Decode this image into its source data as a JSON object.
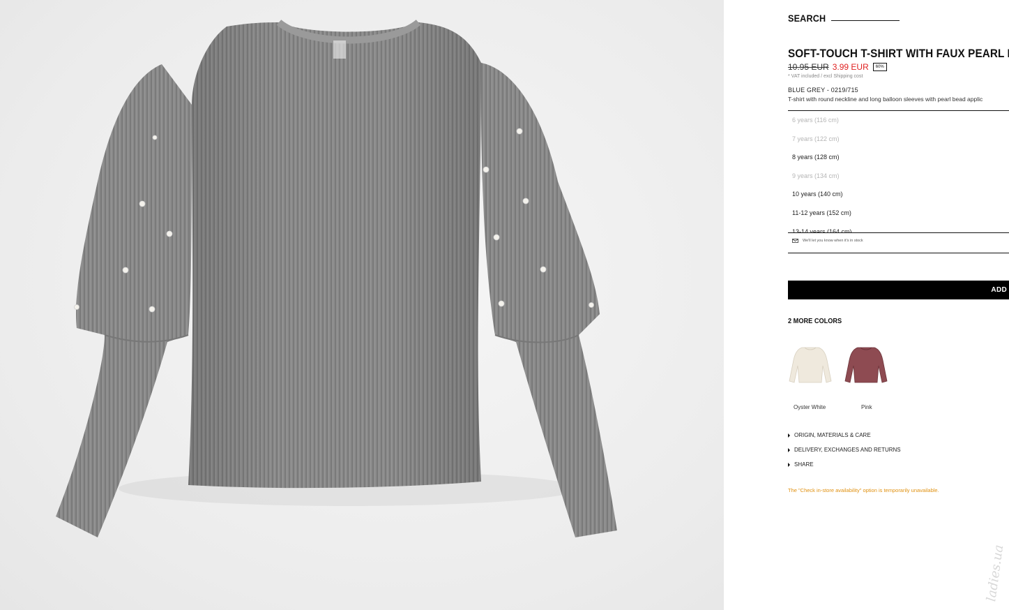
{
  "header": {
    "search_label": "SEARCH"
  },
  "product": {
    "title": "SOFT-TOUCH T-SHIRT WITH FAUX PEARL BEA",
    "old_price": "10.95 EUR",
    "new_price": "3.99 EUR",
    "discount": "60%",
    "vat_note": "* VAT included / excl Shipping cost",
    "color_code": "BLUE GREY - 0219/715",
    "description": "T-shirt with round neckline and long balloon sleeves with pearl bead applic",
    "image_icon": "grey-ribbed-sweater-with-pearls-image"
  },
  "sizes": [
    {
      "label": "6 years (116 cm)",
      "available": false
    },
    {
      "label": "7 years (122 cm)",
      "available": false
    },
    {
      "label": "8 years (128 cm)",
      "available": true
    },
    {
      "label": "9 years (134 cm)",
      "available": false
    },
    {
      "label": "10 years (140 cm)",
      "available": true
    },
    {
      "label": "11-12 years (152 cm)",
      "available": true
    },
    {
      "label": "13-14 years (164 cm)",
      "available": true
    }
  ],
  "notify": {
    "icon": "envelope-icon",
    "text": "We'll let you know when it's in stock"
  },
  "add_button": {
    "label": "ADD"
  },
  "colors": {
    "heading": "2 MORE COLORS",
    "options": [
      {
        "name": "Oyster White",
        "hex": "#efe9dd"
      },
      {
        "name": "Pink",
        "hex": "#8e4b52"
      }
    ]
  },
  "accordion": [
    {
      "label": "ORIGIN, MATERIALS & CARE"
    },
    {
      "label": "DELIVERY, EXCHANGES AND RETURNS"
    },
    {
      "label": "SHARE"
    }
  ],
  "notice": "The \"Check in-store availability\" option is temporarily unavailable.",
  "watermark": "ladies.ua",
  "theme": {
    "accent_red": "#e02020",
    "notice_orange": "#e0900f",
    "sweater_grey": "#8c8c8c"
  }
}
